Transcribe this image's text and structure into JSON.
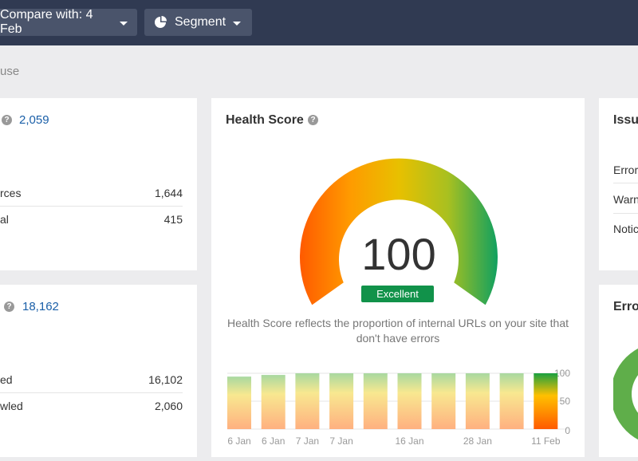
{
  "topbar": {
    "compare_label": "Compare with: 4 Feb",
    "segment_label": "Segment"
  },
  "breadcrumb": "use",
  "card_top_left": {
    "total": "2,059",
    "rows": [
      {
        "label": "rces",
        "value": "1,644"
      },
      {
        "label": "al",
        "value": "415"
      }
    ]
  },
  "card_bottom_left": {
    "total": "18,162",
    "rows": [
      {
        "label": "ed",
        "value": "16,102"
      },
      {
        "label": "wled",
        "value": "2,060"
      }
    ]
  },
  "health": {
    "title": "Health Score",
    "score": "100",
    "badge": "Excellent",
    "description": "Health Score reflects the proportion of internal URLs on your site that don't have errors"
  },
  "issues": {
    "title": "Issu",
    "rows": [
      "Error",
      "Warn",
      "Notic"
    ]
  },
  "errors": {
    "title": "Erro"
  },
  "colors": {
    "topbar": "#303a52",
    "link": "#1a5fa8",
    "badge": "#11924a",
    "errors_ring": "#5fae4a"
  },
  "chart_data": {
    "type": "bar",
    "categories": [
      "6 Jan",
      "6 Jan",
      "7 Jan",
      "7 Jan",
      "",
      "16 Jan",
      "",
      "28 Jan",
      "",
      "11 Feb"
    ],
    "values": [
      94,
      97,
      100,
      100,
      100,
      100,
      100,
      100,
      100,
      100
    ],
    "ylim": [
      0,
      100
    ],
    "yticks": [
      "100",
      "50",
      "0"
    ]
  }
}
